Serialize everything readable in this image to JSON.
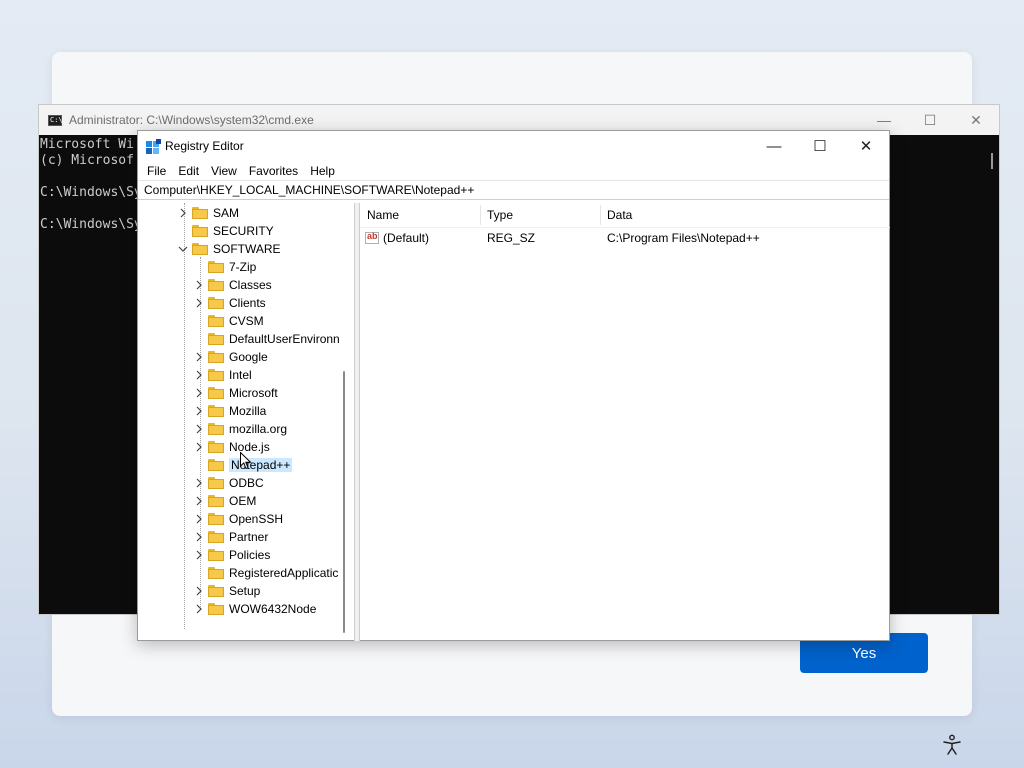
{
  "oobe": {
    "yes_label": "Yes"
  },
  "cmd": {
    "title": "Administrator: C:\\Windows\\system32\\cmd.exe",
    "lines": [
      "Microsoft Wi",
      "(c) Microsof",
      "",
      "C:\\Windows\\Sy",
      "",
      "C:\\Windows\\Sy"
    ]
  },
  "regedit": {
    "title": "Registry Editor",
    "menu": [
      "File",
      "Edit",
      "View",
      "Favorites",
      "Help"
    ],
    "address": "Computer\\HKEY_LOCAL_MACHINE\\SOFTWARE\\Notepad++",
    "tree": [
      {
        "label": "SAM",
        "level": 1,
        "expander": "collapsed"
      },
      {
        "label": "SECURITY",
        "level": 1,
        "expander": "none"
      },
      {
        "label": "SOFTWARE",
        "level": 1,
        "expander": "expanded"
      },
      {
        "label": "7-Zip",
        "level": 2,
        "expander": "none"
      },
      {
        "label": "Classes",
        "level": 2,
        "expander": "collapsed"
      },
      {
        "label": "Clients",
        "level": 2,
        "expander": "collapsed"
      },
      {
        "label": "CVSM",
        "level": 2,
        "expander": "none"
      },
      {
        "label": "DefaultUserEnvironn",
        "level": 2,
        "expander": "none"
      },
      {
        "label": "Google",
        "level": 2,
        "expander": "collapsed"
      },
      {
        "label": "Intel",
        "level": 2,
        "expander": "collapsed"
      },
      {
        "label": "Microsoft",
        "level": 2,
        "expander": "collapsed"
      },
      {
        "label": "Mozilla",
        "level": 2,
        "expander": "collapsed"
      },
      {
        "label": "mozilla.org",
        "level": 2,
        "expander": "collapsed"
      },
      {
        "label": "Node.js",
        "level": 2,
        "expander": "collapsed"
      },
      {
        "label": "Notepad++",
        "level": 2,
        "expander": "none",
        "selected": true
      },
      {
        "label": "ODBC",
        "level": 2,
        "expander": "collapsed"
      },
      {
        "label": "OEM",
        "level": 2,
        "expander": "collapsed"
      },
      {
        "label": "OpenSSH",
        "level": 2,
        "expander": "collapsed"
      },
      {
        "label": "Partner",
        "level": 2,
        "expander": "collapsed"
      },
      {
        "label": "Policies",
        "level": 2,
        "expander": "collapsed"
      },
      {
        "label": "RegisteredApplicatic",
        "level": 2,
        "expander": "none"
      },
      {
        "label": "Setup",
        "level": 2,
        "expander": "collapsed"
      },
      {
        "label": "WOW6432Node",
        "level": 2,
        "expander": "collapsed"
      }
    ],
    "columns": [
      "Name",
      "Type",
      "Data"
    ],
    "values": [
      {
        "name": "(Default)",
        "type": "REG_SZ",
        "data": "C:\\Program Files\\Notepad++"
      }
    ]
  },
  "colors": {
    "accent": "#0062cc",
    "selection": "#cce8ff",
    "folder": "#f6c94a",
    "console_bg": "#0c0c0c"
  },
  "icons": [
    "cmd-app-icon",
    "regedit-app-icon",
    "folder-icon",
    "chevron-right-icon",
    "chevron-down-icon",
    "string-value-icon",
    "accessibility-icon",
    "minimize-icon",
    "maximize-icon",
    "close-icon"
  ]
}
